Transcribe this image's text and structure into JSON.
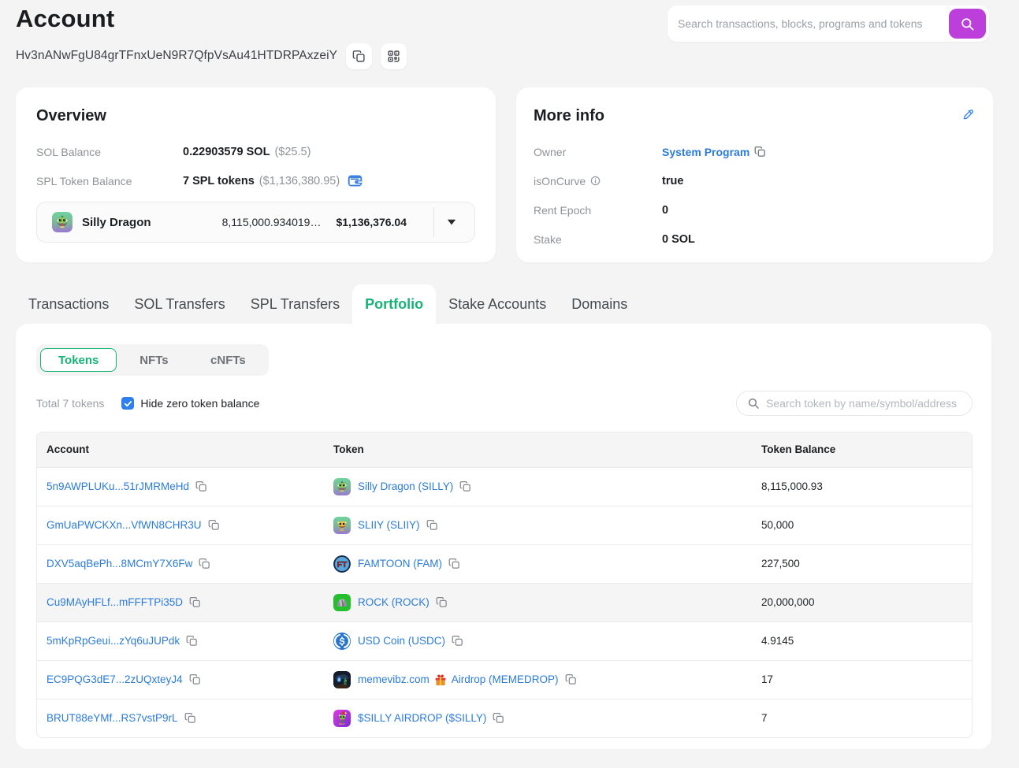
{
  "colors": {
    "accent_purple": "#bc3fdb",
    "accent_green": "#16b377",
    "link_blue": "#2b7bd9",
    "checkbox_blue": "#2f80ed"
  },
  "header": {
    "title": "Account",
    "search_placeholder": "Search transactions, blocks, programs and tokens",
    "search_button_icon": "search-icon"
  },
  "account": {
    "address": "Hv3nANwFgU84grTFnxUeN9R7QfpVsAu41HTDRPAxzeiY",
    "copy_button_icon": "copy-icon",
    "qr_button_icon": "qr-code-icon"
  },
  "overview": {
    "title": "Overview",
    "sol_balance": {
      "label": "SOL Balance",
      "value": "0.22903579 SOL",
      "usd": "($25.5)"
    },
    "spl_balance": {
      "label": "SPL Token Balance",
      "value": "7 SPL tokens",
      "usd": "($1,136,380.95)",
      "icon": "wallet-icon"
    },
    "dropdown": {
      "token": "Silly Dragon",
      "token_icon": "silly-dragon-token-icon",
      "amount": "8,115,000.934019…",
      "usd": "$1,136,376.04",
      "caret_icon": "chevron-down-icon"
    }
  },
  "more_info": {
    "title": "More info",
    "edit_icon": "pencil-icon",
    "owner": {
      "label": "Owner",
      "value": "System Program",
      "copy_icon": "copy-icon"
    },
    "is_on_curve": {
      "label": "isOnCurve",
      "info_icon": "info-icon",
      "value": "true"
    },
    "rent_epoch": {
      "label": "Rent Epoch",
      "value": "0"
    },
    "stake": {
      "label": "Stake",
      "value": "0 SOL"
    }
  },
  "tabs": [
    {
      "label": "Transactions",
      "active": false
    },
    {
      "label": "SOL Transfers",
      "active": false
    },
    {
      "label": "SPL Transfers",
      "active": false
    },
    {
      "label": "Portfolio",
      "active": true
    },
    {
      "label": "Stake Accounts",
      "active": false
    },
    {
      "label": "Domains",
      "active": false
    }
  ],
  "portfolio": {
    "subtabs": [
      {
        "label": "Tokens",
        "active": true
      },
      {
        "label": "NFTs",
        "active": false
      },
      {
        "label": "cNFTs",
        "active": false
      }
    ],
    "total_label": "Total 7 tokens",
    "hide_zero": {
      "label": "Hide zero token balance",
      "checked": true
    },
    "search_placeholder": "Search token by name/symbol/address",
    "table": {
      "columns": [
        "Account",
        "Token",
        "Token Balance"
      ],
      "rows": [
        {
          "account": "5n9AWPLUKu...51rJMRMeHd",
          "token": "Silly Dragon (SILLY)",
          "icon": "silly-dragon-token-icon",
          "balance": "8,115,000.93",
          "highlight": false
        },
        {
          "account": "GmUaPWCKXn...VfWN8CHR3U",
          "token": "SLIIY (SLIIY)",
          "icon": "sliiy-token-icon",
          "balance": "50,000",
          "highlight": false
        },
        {
          "account": "DXV5aqBePh...8MCmY7X6Fw",
          "token": "FAMTOON (FAM)",
          "icon": "famtoon-token-icon",
          "balance": "227,500",
          "highlight": false
        },
        {
          "account": "Cu9MAyHFLf...mFFFTPi35D",
          "token": "ROCK (ROCK)",
          "icon": "rock-token-icon",
          "balance": "20,000,000",
          "highlight": true
        },
        {
          "account": "5mKpRpGeui...zYq6uJUPdk",
          "token": "USD Coin (USDC)",
          "icon": "usdc-token-icon",
          "balance": "4.9145",
          "highlight": false
        },
        {
          "account": "EC9PQG3dE7...2zUQxteyJ4",
          "token": "memevibz.com",
          "token_after_gift": "Airdrop (MEMEDROP)",
          "gift_icon": "gift-icon",
          "icon": "memedrop-token-icon",
          "balance": "17",
          "highlight": false
        },
        {
          "account": "BRUT88eYMf...RS7vstP9rL",
          "token": "$SILLY AIRDROP ($SILLY)",
          "icon": "silly-airdrop-token-icon",
          "balance": "7",
          "highlight": false
        }
      ]
    }
  }
}
